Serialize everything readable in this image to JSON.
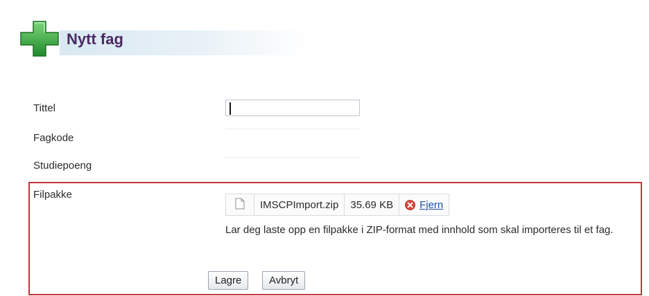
{
  "header": {
    "title": "Nytt fag",
    "icon": "plus-icon",
    "icon_color": "#2fa83a"
  },
  "form": {
    "title_label": "Tittel",
    "title_value": "",
    "code_label": "Fagkode",
    "credits_label": "Studiepoeng",
    "package_label": "Filpakke"
  },
  "file": {
    "icon": "file-icon",
    "name": "IMSCPImport.zip",
    "size": "35.69 KB",
    "remove_label": "Fjern",
    "remove_icon": "remove-icon",
    "remove_icon_color": "#d9453c"
  },
  "help_text": "Lar deg laste opp en filpakke i ZIP-format med innhold som skal importeres til et fag.",
  "buttons": {
    "save_label": "Lagre",
    "cancel_label": "Avbryt"
  },
  "colors": {
    "title": "#4a2a63",
    "highlight_border": "#c8333a",
    "link": "#1f4fa8"
  }
}
